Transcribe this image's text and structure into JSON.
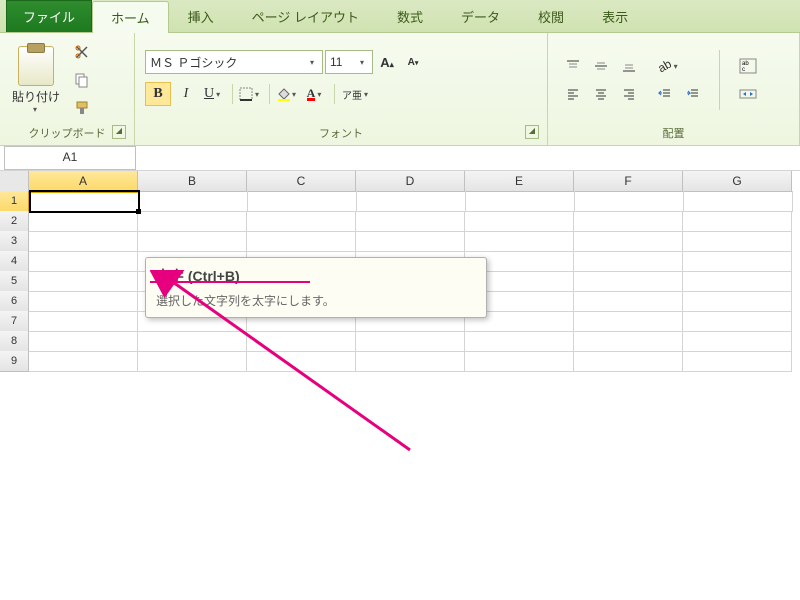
{
  "tabs": {
    "file": "ファイル",
    "home": "ホーム",
    "insert": "挿入",
    "pagelayout": "ページ レイアウト",
    "formulas": "数式",
    "data": "データ",
    "review": "校閲",
    "view": "表示"
  },
  "clipboard": {
    "paste": "貼り付け",
    "group_label": "クリップボード"
  },
  "font": {
    "name": "ＭＳ Ｐゴシック",
    "size": "11",
    "bold": "B",
    "italic": "I",
    "underline": "U",
    "group_label": "フォント",
    "ruby": "ア亜"
  },
  "alignment": {
    "group_label": "配置"
  },
  "namebox": "A1",
  "columns": [
    "A",
    "B",
    "C",
    "D",
    "E",
    "F",
    "G"
  ],
  "rows": [
    "1",
    "2",
    "3",
    "4",
    "5",
    "6",
    "7",
    "8",
    "9"
  ],
  "tooltip": {
    "title": "太字 (Ctrl+B)",
    "body": "選択した文字列を太字にします。"
  }
}
